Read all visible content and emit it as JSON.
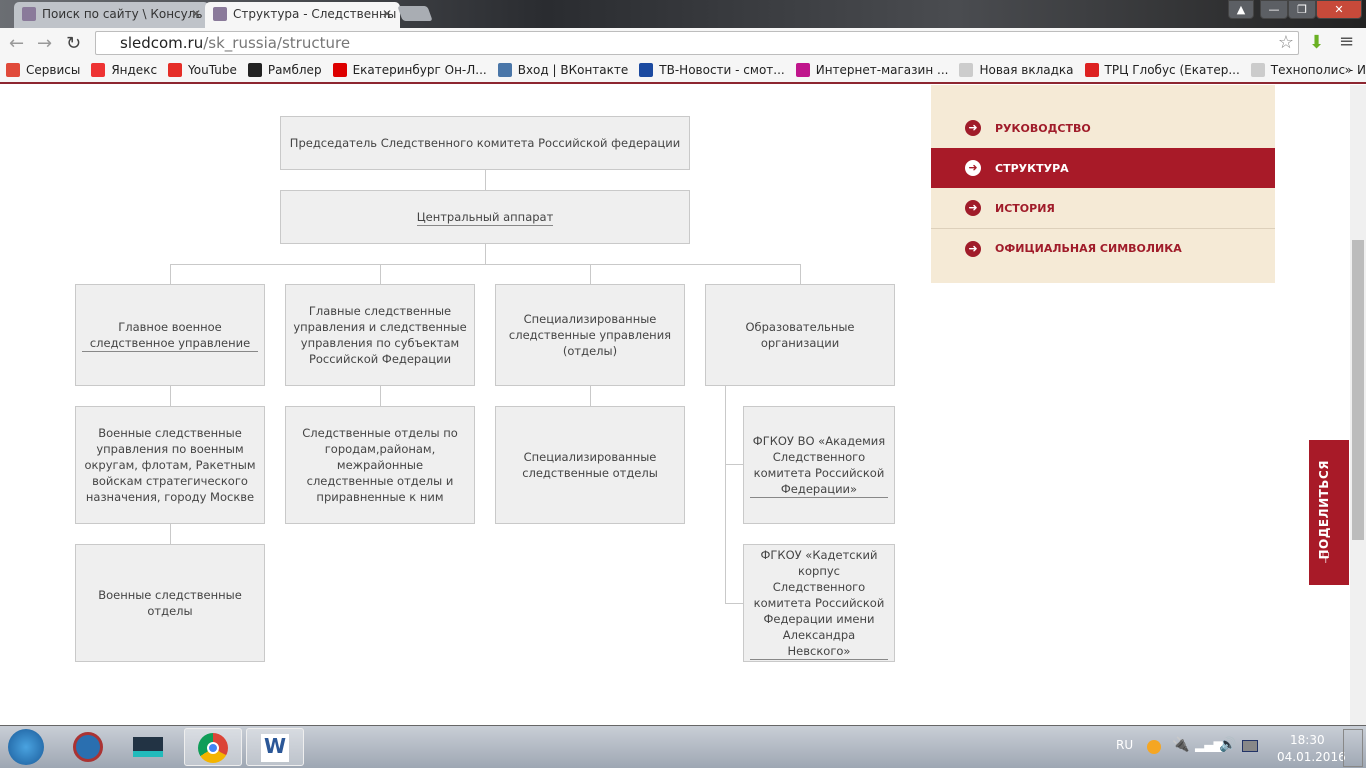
{
  "browser": {
    "tabs": [
      {
        "title": "Поиск по сайту \\ Консуль",
        "close": "✕"
      },
      {
        "title": "Структура - Следственны",
        "close": "✕"
      }
    ],
    "url_host": "sledcom.ru",
    "url_path": "/sk_russia/structure",
    "window_buttons": [
      "▲",
      "—",
      "❐",
      "✕"
    ],
    "bookmarks": [
      {
        "label": "Сервисы",
        "color": "#e04a3a"
      },
      {
        "label": "Яндекс",
        "color": "#e33"
      },
      {
        "label": "YouTube",
        "color": "#e52d27"
      },
      {
        "label": "Рамблер",
        "color": "#222"
      },
      {
        "label": "Екатеринбург Он-Л...",
        "color": "#d00"
      },
      {
        "label": "Вход | ВКонтакте",
        "color": "#4a76a8"
      },
      {
        "label": "ТВ-Новости - смот...",
        "color": "#1c4aa0"
      },
      {
        "label": "Интернет-магазин ...",
        "color": "#c0158c"
      },
      {
        "label": "Новая вкладка",
        "color": "#ccc"
      },
      {
        "label": "ТРЦ Глобус (Екатер...",
        "color": "#d22"
      },
      {
        "label": "Технополис - Инте...",
        "color": "#ccc"
      }
    ],
    "more": "»"
  },
  "org": {
    "chairman": "Председатель Следственного комитета Российской федерации",
    "central": "Центральный аппарат",
    "col1": [
      "Главное военное следственное управление",
      "Военные следственные управления по военным округам, флотам, Ракетным войскам стратегического назначения, городу Москве",
      "Военные следственные отделы"
    ],
    "col2": [
      "Главные следственные управления и следственные управления по субъектам Российской Федерации",
      "Следственные отделы по городам,районам, межрайонные следственные отделы и приравненные к ним"
    ],
    "col3": [
      "Специализированные следственные управления (отделы)",
      "Специализированные следственные отделы"
    ],
    "col4": [
      "Образовательные организации",
      "ФГКОУ ВО «Академия Следственного комитета Российской Федерации»",
      "ФГКОУ «Кадетский корпус Следственного комитета Российской Федерации имени Александра Невского»"
    ]
  },
  "sidebar": {
    "items": [
      {
        "label": "РУКОВОДСТВО"
      },
      {
        "label": "СТРУКТУРА",
        "active": true
      },
      {
        "label": "ИСТОРИЯ"
      },
      {
        "label": "ОФИЦИАЛЬНАЯ СИМВОЛИКА"
      }
    ],
    "accent": "#a81a28"
  },
  "share": {
    "label": "ПОДЕЛИТЬСЯ"
  },
  "taskbar": {
    "lang": "RU",
    "time": "18:30",
    "date": "04.01.2016"
  }
}
